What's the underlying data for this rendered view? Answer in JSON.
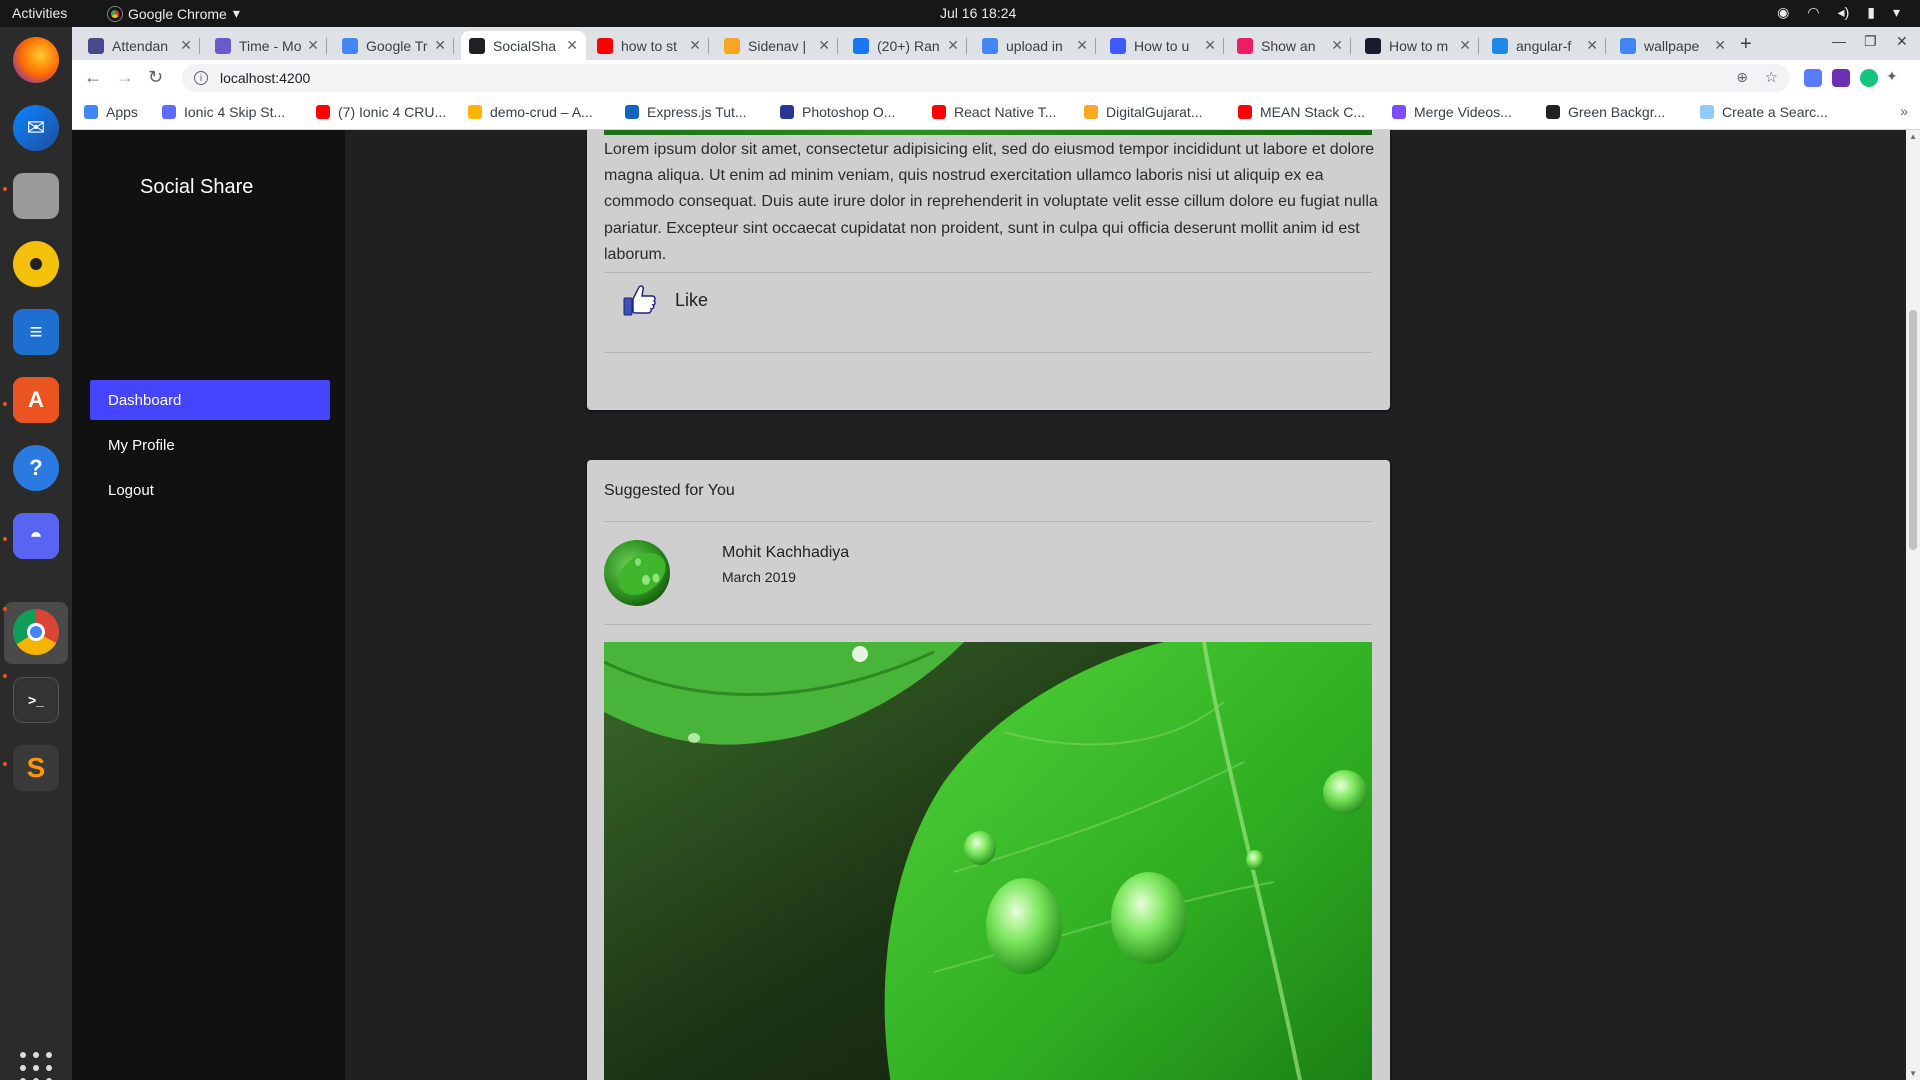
{
  "system": {
    "activities": "Activities",
    "app_name": "Google Chrome",
    "clock": "Jul 16  18:24"
  },
  "dock": {
    "apps": [
      "firefox-icon",
      "thunderbird-icon",
      "files-icon",
      "rhythmbox-icon",
      "writer-icon",
      "software-icon",
      "help-icon",
      "discord-icon",
      "chrome-icon",
      "terminal-icon",
      "sublime-icon"
    ],
    "show_apps": "show-apps-icon"
  },
  "browser": {
    "tabs": [
      {
        "label": "Attendan",
        "color": "#4a4a8a"
      },
      {
        "label": "Time - Mo",
        "color": "#6a5acd"
      },
      {
        "label": "Google Tr",
        "color": "#4285f4"
      },
      {
        "label": "SocialSha",
        "color": "#202124"
      },
      {
        "label": "how to st",
        "color": "#ff0000"
      },
      {
        "label": "Sidenav |",
        "color": "#f5a623"
      },
      {
        "label": "(20+) Ran",
        "color": "#1877f2"
      },
      {
        "label": "upload in",
        "color": "#4285f4"
      },
      {
        "label": "How to u",
        "color": "#3d5afe"
      },
      {
        "label": "Show an",
        "color": "#e91e63"
      },
      {
        "label": "How to m",
        "color": "#1a1a2e"
      },
      {
        "label": "angular-f",
        "color": "#1e88e5"
      },
      {
        "label": "wallpape",
        "color": "#4285f4"
      }
    ],
    "new_tab": "+",
    "url": "localhost:4200",
    "bookmarks": [
      {
        "label": "Apps",
        "color": "#4285f4"
      },
      {
        "label": "Ionic 4 Skip St...",
        "color": "#5b6cff"
      },
      {
        "label": "(7) Ionic 4 CRU...",
        "color": "#ff0000"
      },
      {
        "label": "demo-crud – A...",
        "color": "#ffb300"
      },
      {
        "label": "Express.js Tut...",
        "color": "#1565c0"
      },
      {
        "label": "Photoshop O...",
        "color": "#283593"
      },
      {
        "label": "React Native T...",
        "color": "#ff0000"
      },
      {
        "label": "DigitalGujarat...",
        "color": "#f9a825"
      },
      {
        "label": "MEAN Stack C...",
        "color": "#ff0000"
      },
      {
        "label": "Merge Videos...",
        "color": "#7c4dff"
      },
      {
        "label": "Green Backgr...",
        "color": "#202124"
      },
      {
        "label": "Create a Searc...",
        "color": "#90caf9"
      }
    ],
    "bookmarks_more": "»"
  },
  "app": {
    "brand": "Social Share",
    "nav": [
      {
        "label": "Dashboard",
        "active": true
      },
      {
        "label": "My Profile",
        "active": false
      },
      {
        "label": "Logout",
        "active": false
      }
    ],
    "post": {
      "text": "Lorem ipsum dolor sit amet, consectetur adipisicing elit, sed do eiusmod tempor incididunt ut labore et dolore magna aliqua. Ut enim ad minim veniam, quis nostrud exercitation ullamco laboris nisi ut aliquip ex ea commodo consequat. Duis aute irure dolor in reprehenderit in voluptate velit esse cillum dolore eu fugiat nulla pariatur. Excepteur sint occaecat cupidatat non proident, sunt in culpa qui officia deserunt mollit anim id est laborum.",
      "like_label": "Like"
    },
    "suggested": {
      "header": "Suggested for You",
      "author": "Mohit Kachhadiya",
      "date": "March 2019"
    }
  },
  "colors": {
    "accent": "#4545ff",
    "card": "#cfcfcf",
    "sidenav": "#111111"
  }
}
